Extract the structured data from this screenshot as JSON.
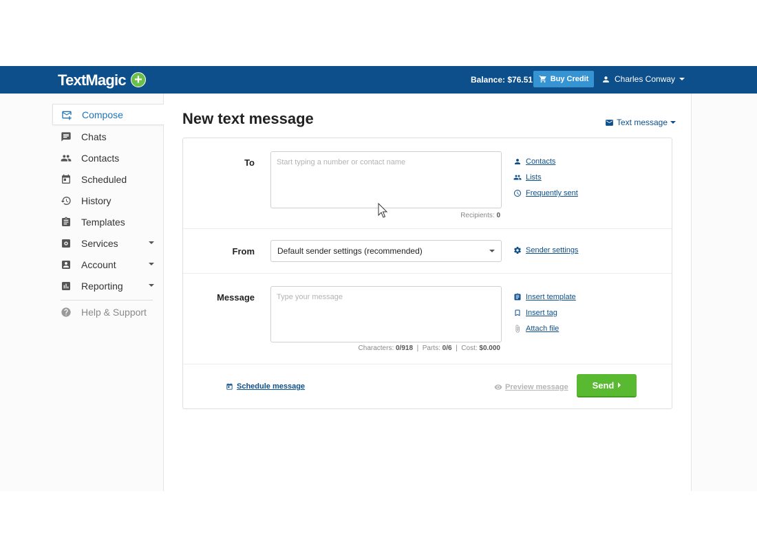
{
  "header": {
    "logo_text": "TextMagic",
    "logo_plus": "+",
    "balance": "Balance: $76.51",
    "buy_credit": "Buy Credit",
    "user_name": "Charles Conway"
  },
  "colors": {
    "header_bg": "#0d4f8b",
    "accent_link": "#0d4f8b",
    "buy_button": "#3794d3",
    "send_button": "#59b931",
    "logo_plus": "#6cc04a"
  },
  "sidebar": {
    "items": [
      {
        "label": "Compose",
        "icon": "compose-icon",
        "active": true
      },
      {
        "label": "Chats",
        "icon": "chat-icon"
      },
      {
        "label": "Contacts",
        "icon": "contacts-icon"
      },
      {
        "label": "Scheduled",
        "icon": "calendar-icon"
      },
      {
        "label": "History",
        "icon": "history-icon"
      },
      {
        "label": "Templates",
        "icon": "clipboard-icon"
      },
      {
        "label": "Services",
        "icon": "services-icon",
        "expandable": true
      },
      {
        "label": "Account",
        "icon": "account-icon",
        "expandable": true
      },
      {
        "label": "Reporting",
        "icon": "bar-chart-icon",
        "expandable": true
      }
    ],
    "help": {
      "label": "Help & Support",
      "icon": "help-icon"
    }
  },
  "main": {
    "title": "New text message",
    "message_type": "Text message",
    "to": {
      "label": "To",
      "placeholder": "Start typing a number or contact name",
      "recipients_label": "Recipients:",
      "recipients_value": "0",
      "links": [
        "Contacts",
        "Lists",
        "Frequently sent"
      ]
    },
    "from": {
      "label": "From",
      "selected": "Default sender settings (recommended)",
      "link": "Sender settings"
    },
    "message": {
      "label": "Message",
      "placeholder": "Type your message",
      "characters_label": "Characters:",
      "characters_value": "0/918",
      "parts_label": "Parts:",
      "parts_value": "0/6",
      "cost_label": "Cost:",
      "cost_value": "$0.000",
      "links": [
        "Insert template",
        "Insert tag",
        "Attach file"
      ]
    },
    "footer": {
      "schedule": "Schedule message",
      "preview": "Preview message",
      "send": "Send"
    }
  }
}
